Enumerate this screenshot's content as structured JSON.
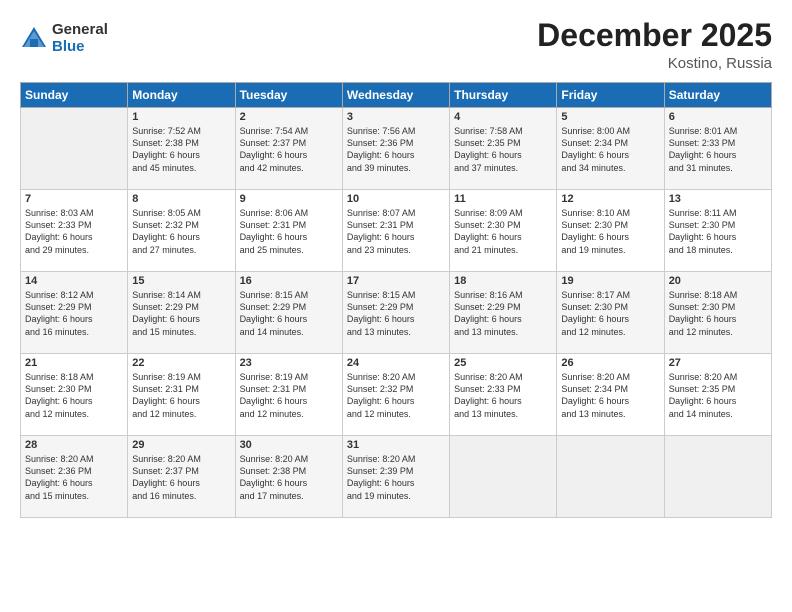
{
  "header": {
    "logo_general": "General",
    "logo_blue": "Blue",
    "title": "December 2025",
    "location": "Kostino, Russia"
  },
  "columns": [
    "Sunday",
    "Monday",
    "Tuesday",
    "Wednesday",
    "Thursday",
    "Friday",
    "Saturday"
  ],
  "weeks": [
    {
      "days": [
        {
          "num": "",
          "info": "",
          "empty": true
        },
        {
          "num": "1",
          "info": "Sunrise: 7:52 AM\nSunset: 2:38 PM\nDaylight: 6 hours\nand 45 minutes."
        },
        {
          "num": "2",
          "info": "Sunrise: 7:54 AM\nSunset: 2:37 PM\nDaylight: 6 hours\nand 42 minutes."
        },
        {
          "num": "3",
          "info": "Sunrise: 7:56 AM\nSunset: 2:36 PM\nDaylight: 6 hours\nand 39 minutes."
        },
        {
          "num": "4",
          "info": "Sunrise: 7:58 AM\nSunset: 2:35 PM\nDaylight: 6 hours\nand 37 minutes."
        },
        {
          "num": "5",
          "info": "Sunrise: 8:00 AM\nSunset: 2:34 PM\nDaylight: 6 hours\nand 34 minutes."
        },
        {
          "num": "6",
          "info": "Sunrise: 8:01 AM\nSunset: 2:33 PM\nDaylight: 6 hours\nand 31 minutes."
        }
      ]
    },
    {
      "days": [
        {
          "num": "7",
          "info": "Sunrise: 8:03 AM\nSunset: 2:33 PM\nDaylight: 6 hours\nand 29 minutes."
        },
        {
          "num": "8",
          "info": "Sunrise: 8:05 AM\nSunset: 2:32 PM\nDaylight: 6 hours\nand 27 minutes."
        },
        {
          "num": "9",
          "info": "Sunrise: 8:06 AM\nSunset: 2:31 PM\nDaylight: 6 hours\nand 25 minutes."
        },
        {
          "num": "10",
          "info": "Sunrise: 8:07 AM\nSunset: 2:31 PM\nDaylight: 6 hours\nand 23 minutes."
        },
        {
          "num": "11",
          "info": "Sunrise: 8:09 AM\nSunset: 2:30 PM\nDaylight: 6 hours\nand 21 minutes."
        },
        {
          "num": "12",
          "info": "Sunrise: 8:10 AM\nSunset: 2:30 PM\nDaylight: 6 hours\nand 19 minutes."
        },
        {
          "num": "13",
          "info": "Sunrise: 8:11 AM\nSunset: 2:30 PM\nDaylight: 6 hours\nand 18 minutes."
        }
      ]
    },
    {
      "days": [
        {
          "num": "14",
          "info": "Sunrise: 8:12 AM\nSunset: 2:29 PM\nDaylight: 6 hours\nand 16 minutes."
        },
        {
          "num": "15",
          "info": "Sunrise: 8:14 AM\nSunset: 2:29 PM\nDaylight: 6 hours\nand 15 minutes."
        },
        {
          "num": "16",
          "info": "Sunrise: 8:15 AM\nSunset: 2:29 PM\nDaylight: 6 hours\nand 14 minutes."
        },
        {
          "num": "17",
          "info": "Sunrise: 8:15 AM\nSunset: 2:29 PM\nDaylight: 6 hours\nand 13 minutes."
        },
        {
          "num": "18",
          "info": "Sunrise: 8:16 AM\nSunset: 2:29 PM\nDaylight: 6 hours\nand 13 minutes."
        },
        {
          "num": "19",
          "info": "Sunrise: 8:17 AM\nSunset: 2:30 PM\nDaylight: 6 hours\nand 12 minutes."
        },
        {
          "num": "20",
          "info": "Sunrise: 8:18 AM\nSunset: 2:30 PM\nDaylight: 6 hours\nand 12 minutes."
        }
      ]
    },
    {
      "days": [
        {
          "num": "21",
          "info": "Sunrise: 8:18 AM\nSunset: 2:30 PM\nDaylight: 6 hours\nand 12 minutes."
        },
        {
          "num": "22",
          "info": "Sunrise: 8:19 AM\nSunset: 2:31 PM\nDaylight: 6 hours\nand 12 minutes."
        },
        {
          "num": "23",
          "info": "Sunrise: 8:19 AM\nSunset: 2:31 PM\nDaylight: 6 hours\nand 12 minutes."
        },
        {
          "num": "24",
          "info": "Sunrise: 8:20 AM\nSunset: 2:32 PM\nDaylight: 6 hours\nand 12 minutes."
        },
        {
          "num": "25",
          "info": "Sunrise: 8:20 AM\nSunset: 2:33 PM\nDaylight: 6 hours\nand 13 minutes."
        },
        {
          "num": "26",
          "info": "Sunrise: 8:20 AM\nSunset: 2:34 PM\nDaylight: 6 hours\nand 13 minutes."
        },
        {
          "num": "27",
          "info": "Sunrise: 8:20 AM\nSunset: 2:35 PM\nDaylight: 6 hours\nand 14 minutes."
        }
      ]
    },
    {
      "days": [
        {
          "num": "28",
          "info": "Sunrise: 8:20 AM\nSunset: 2:36 PM\nDaylight: 6 hours\nand 15 minutes."
        },
        {
          "num": "29",
          "info": "Sunrise: 8:20 AM\nSunset: 2:37 PM\nDaylight: 6 hours\nand 16 minutes."
        },
        {
          "num": "30",
          "info": "Sunrise: 8:20 AM\nSunset: 2:38 PM\nDaylight: 6 hours\nand 17 minutes."
        },
        {
          "num": "31",
          "info": "Sunrise: 8:20 AM\nSunset: 2:39 PM\nDaylight: 6 hours\nand 19 minutes."
        },
        {
          "num": "",
          "info": "",
          "empty": true
        },
        {
          "num": "",
          "info": "",
          "empty": true
        },
        {
          "num": "",
          "info": "",
          "empty": true
        }
      ]
    }
  ]
}
